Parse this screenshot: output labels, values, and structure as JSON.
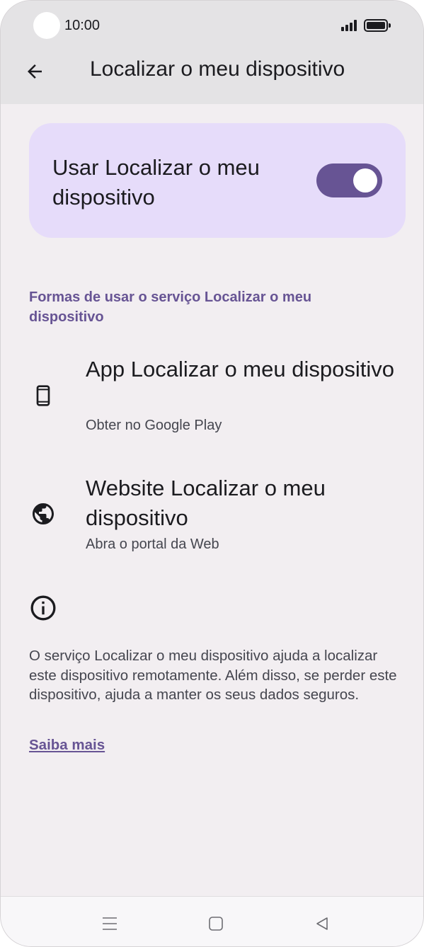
{
  "status_bar": {
    "time": "10:00"
  },
  "app_bar": {
    "title": "Localizar o meu dispositivo",
    "back_icon": "arrow-back-icon"
  },
  "main_toggle": {
    "label": "Usar Localizar o meu dispositivo",
    "enabled": true,
    "accent_color": "#675494",
    "card_color": "#e6dcfa"
  },
  "section": {
    "header": "Formas de usar o serviço Localizar o meu dispositivo"
  },
  "items": [
    {
      "icon": "smartphone-icon",
      "title": "App Localizar o meu dispositivo",
      "subtitle": "Obter no Google Play"
    },
    {
      "icon": "globe-icon",
      "title": "Website Localizar o meu dispositivo",
      "subtitle": "Abra o portal da Web"
    }
  ],
  "info": {
    "icon": "info-icon",
    "text": "O serviço Localizar o meu dispositivo ajuda a localizar este dispositivo remotamente. Além disso, se perder este dispositivo, ajuda a manter os seus dados seguros.",
    "link_label": "Saiba mais"
  },
  "navigation": {
    "buttons": [
      "menu-icon",
      "home-icon",
      "back-triangle-icon"
    ]
  }
}
